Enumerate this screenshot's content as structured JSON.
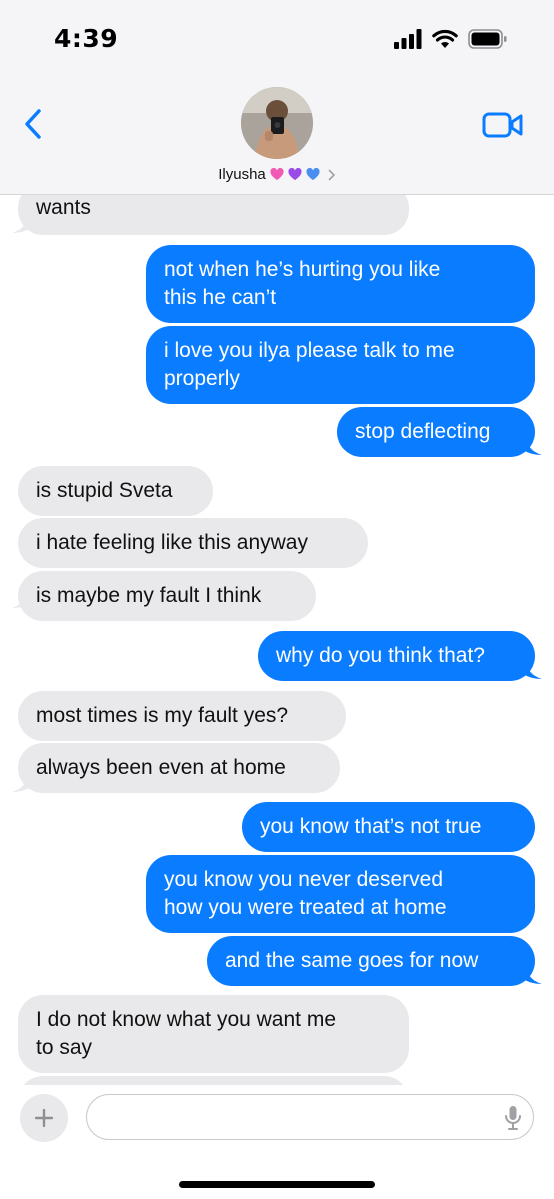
{
  "status_bar": {
    "time": "4:39"
  },
  "header": {
    "contact_name": "Ilyusha",
    "heart_colors": [
      "#f05ab4",
      "#9b4be8",
      "#4a8ff0"
    ]
  },
  "colors": {
    "sent_bubble": "#0a7cff",
    "received_bubble": "#e9e9eb",
    "accent": "#0a7cff"
  },
  "messages": [
    {
      "side": "recv",
      "text": "wants"
    },
    {
      "side": "sent",
      "text": "not when he’s hurting you like\nthis he can’t"
    },
    {
      "side": "sent",
      "text": "i love you ilya please talk to me\nproperly"
    },
    {
      "side": "sent",
      "text": "stop deflecting"
    },
    {
      "side": "recv",
      "text": "is stupid Sveta"
    },
    {
      "side": "recv",
      "text": "i hate feeling like this anyway"
    },
    {
      "side": "recv",
      "text": "is maybe my fault I think"
    },
    {
      "side": "sent",
      "text": "why do you think that?"
    },
    {
      "side": "recv",
      "text": "most times is my fault yes?"
    },
    {
      "side": "recv",
      "text": "always been even at home"
    },
    {
      "side": "sent",
      "text": "you know that’s not true"
    },
    {
      "side": "sent",
      "text": "you know you never deserved\nhow you were treated at home"
    },
    {
      "side": "sent",
      "text": "and the same goes for now"
    },
    {
      "side": "recv",
      "text": "I do not know what you want me\nto say"
    },
    {
      "side": "recv",
      "text": ""
    }
  ],
  "input": {
    "value": "",
    "placeholder": ""
  },
  "icons": {
    "back": "chevron-left-icon",
    "video": "video-camera-icon",
    "add": "plus-icon",
    "mic": "microphone-icon",
    "signal": "cellular-signal-icon",
    "wifi": "wifi-icon",
    "battery": "battery-icon"
  }
}
